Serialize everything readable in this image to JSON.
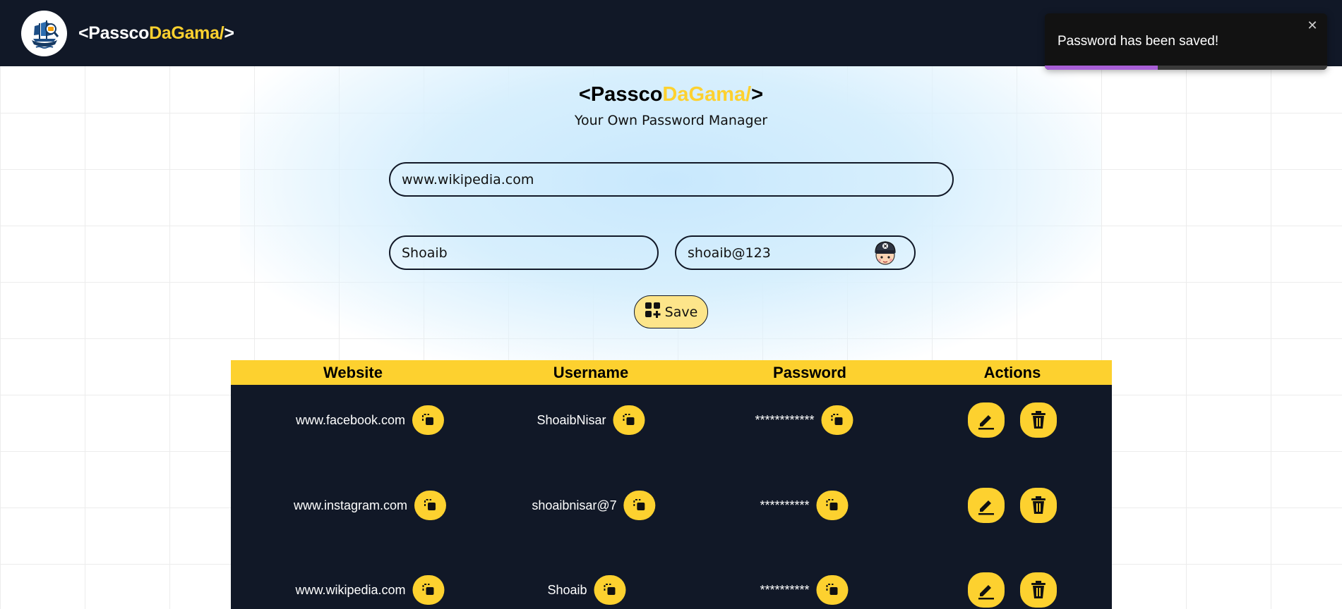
{
  "navbar": {
    "brand_open": "<Passco",
    "brand_accent": "DaGama/",
    "brand_close": ">"
  },
  "header": {
    "title_open": "<Passco",
    "title_accent": "DaGama/",
    "title_close": ">",
    "subtitle": "Your Own Password Manager"
  },
  "form": {
    "website_value": "www.wikipedia.com",
    "username_value": "Shoaib",
    "password_value": "shoaib@123",
    "save_label": "Save"
  },
  "table": {
    "headers": [
      "Website",
      "Username",
      "Password",
      "Actions"
    ],
    "rows": [
      {
        "website": "www.facebook.com",
        "username": "ShoaibNisar",
        "password": "************"
      },
      {
        "website": "www.instagram.com",
        "username": "shoaibnisar@7",
        "password": "**********"
      },
      {
        "website": "www.wikipedia.com",
        "username": "Shoaib",
        "password": "**********"
      }
    ]
  },
  "toast": {
    "message": "Password has been saved!",
    "close_glyph": "✕",
    "progress": 0.4
  },
  "colors": {
    "navbar": "#111827",
    "accent": "#fdd12f",
    "toast_progress": "#a85fd6"
  }
}
